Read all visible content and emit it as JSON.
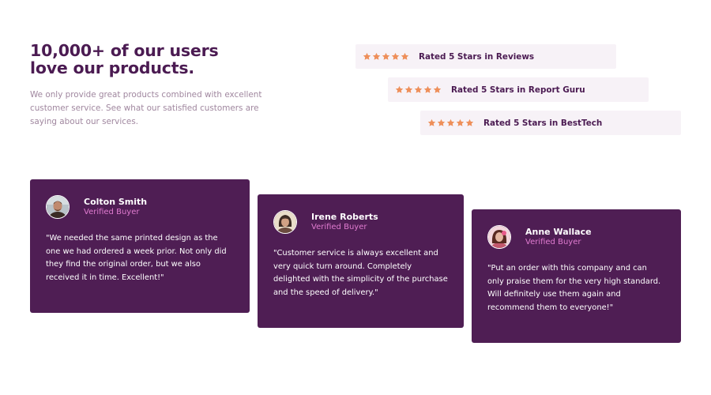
{
  "header": {
    "title_line1": "10,000+ of our users",
    "title_line2": "love our products.",
    "description": "We only provide great products combined with excellent customer service. See what our satisfied customers are saying about our services."
  },
  "ratings": [
    {
      "label": "Rated 5 Stars in Reviews",
      "stars": 5
    },
    {
      "label": "Rated 5 Stars in Report Guru",
      "stars": 5
    },
    {
      "label": "Rated 5 Stars in BestTech",
      "stars": 5
    }
  ],
  "testimonials": [
    {
      "name": "Colton Smith",
      "badge": "Verified Buyer",
      "quote": "\"We needed the same printed design as the one we had ordered a week prior. Not only did they find the original order, but we also received it in time. Excellent!\""
    },
    {
      "name": "Irene Roberts",
      "badge": "Verified Buyer",
      "quote": "\"Customer service is always excellent and very quick turn around. Completely delighted with the simplicity of the purchase and the speed of delivery.\""
    },
    {
      "name": "Anne Wallace",
      "badge": "Verified Buyer",
      "quote": "\"Put an order with this company and can only praise them for the very high standard. Will definitely use them again and recommend them to everyone!\""
    }
  ],
  "colors": {
    "primary": "#4b1b52",
    "card_bg": "#4f1e54",
    "muted_text": "#a0879f",
    "accent_pink": "#e07bd0",
    "star": "#ee8f5a",
    "rating_bg": "#f7f2f7"
  },
  "icons": {
    "star": "star-icon",
    "avatars": [
      "avatar-colton",
      "avatar-irene",
      "avatar-anne"
    ]
  }
}
